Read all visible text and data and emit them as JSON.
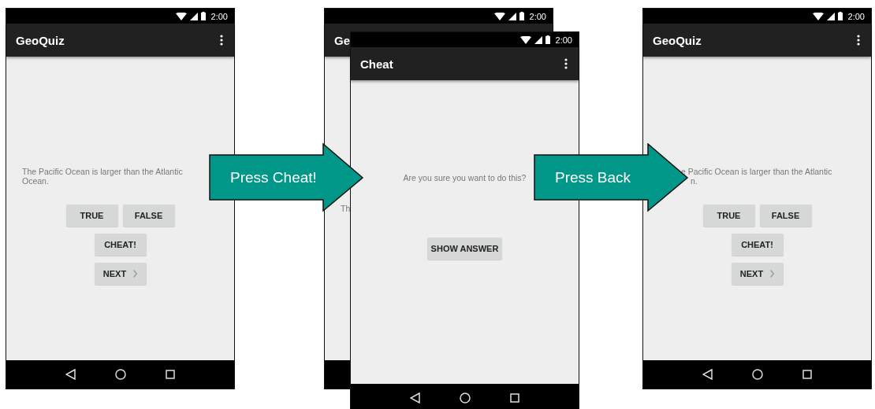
{
  "phones": [
    {
      "kind": "quiz",
      "status_time": "2:00",
      "title": "GeoQuiz",
      "menu": true,
      "nav_buttons": true,
      "question_lines": [
        "The Pacific Ocean is larger than the Atlantic",
        "Ocean."
      ],
      "button_rows": [
        [
          {
            "kind": "plain",
            "label": "TRUE"
          },
          {
            "kind": "plain",
            "label": "FALSE"
          }
        ],
        [
          {
            "kind": "plain",
            "label": "CHEAT!"
          }
        ],
        [
          {
            "kind": "next",
            "label": "NEXT"
          }
        ]
      ]
    },
    {
      "kind": "behind",
      "status_time": "2:00",
      "title": "Ge",
      "question_lines": [
        "Th"
      ]
    },
    {
      "kind": "cheat",
      "status_time": "2:00",
      "title": "Cheat",
      "menu": true,
      "nav_buttons": true,
      "message": "Are you sure you want to do this?",
      "action": "SHOW ANSWER"
    },
    {
      "kind": "quiz",
      "status_time": "2:00",
      "title": "GeoQuiz",
      "menu": true,
      "nav_buttons": true,
      "covered": true,
      "question_lines": [
        "e Pacific Ocean is larger than the Atlantic",
        "n."
      ],
      "button_rows": [
        [
          {
            "kind": "plain",
            "label": "TRUE"
          },
          {
            "kind": "plain",
            "label": "FALSE"
          }
        ],
        [
          {
            "kind": "plain",
            "label": "CHEAT!"
          }
        ],
        [
          {
            "kind": "next",
            "label": "NEXT"
          }
        ]
      ]
    }
  ],
  "arrows": [
    {
      "label": "Press Cheat!"
    },
    {
      "label": "Press Back"
    }
  ]
}
